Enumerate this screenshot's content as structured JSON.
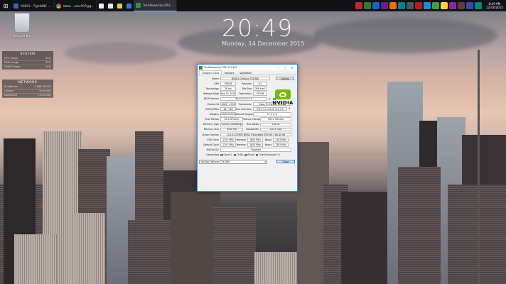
{
  "taskbar": {
    "windows": [
      {
        "label": "A0001 - TightVNC ...",
        "color": "#2a6ebd"
      },
      {
        "label": "Inbox - udu.007@g...",
        "color": "#d44235"
      },
      {
        "label": "TechPowerUp GPU-...",
        "color": "#3a8d3a"
      }
    ],
    "pinned_colors": [
      "#f2f2f2",
      "#e8e8e8",
      "#f0c040",
      "#2b7bd6"
    ],
    "tray_colors": [
      "#c62828",
      "#2e7d32",
      "#1565c0",
      "#6a1b9a",
      "#ef6c00",
      "#00838f",
      "#455a64",
      "#b71c1c",
      "#1e88e5",
      "#43a047",
      "#fdd835",
      "#8e24aa",
      "#5d4037",
      "#3949ab",
      "#00897b"
    ],
    "time": "8:49 PM",
    "date": "12/14/2015"
  },
  "lockscreen": {
    "time": "20:49",
    "date": "Monday, 14 December 2015"
  },
  "desktop": {
    "recycle_bin_label": "Recycle Bin"
  },
  "system_widget": {
    "title": "SYSTEM",
    "rows": [
      {
        "label": "CPU Usage",
        "value": "13%"
      },
      {
        "label": "RAM Usage",
        "value": "42%"
      },
      {
        "label": "SWAP Usage",
        "value": "24%"
      }
    ]
  },
  "network_widget": {
    "title": "NETWORK",
    "rows": [
      {
        "label": "IP Address",
        "value": "1.186.98.125"
      },
      {
        "label": "Upload",
        "value": "54.0 kB/s"
      },
      {
        "label": "Download",
        "value": "113.4 kB/s"
      }
    ]
  },
  "gpuz": {
    "title": "TechPowerUp GPU-Z 0.8.6",
    "tabs": [
      "Graphics Card",
      "Sensors",
      "Validation"
    ],
    "name_label": "Name",
    "name": "NVIDIA GeForce GTX 980",
    "lookup": "Lookup",
    "gpu_label": "GPU",
    "gpu": "GM204",
    "revision_label": "Revision",
    "revision": "A1",
    "tech_label": "Technology",
    "tech": "28 nm",
    "die_label": "Die Size",
    "die": "398 mm²",
    "release_label": "Release Date",
    "release": "Sep 19, 2014",
    "transistors_label": "Transistors",
    "transistors": "5200M",
    "bios_label": "BIOS Version",
    "bios": "84.04.1F.00.C8",
    "uefi": "UEFI",
    "device_label": "Device ID",
    "device": "10DE - 13C0",
    "subvendor_label": "Subvendor",
    "subvendor": "Zotac PC Partner (19DA)",
    "rops_label": "ROPs/TMUs",
    "rops": "64 / 128",
    "bus_label": "Bus Interface",
    "bus": "PCI-E 3.0 x16 @ x16 3.0",
    "shaders_label": "Shaders",
    "shaders": "2048 Unified",
    "dx_label": "DirectX Support",
    "dx": "12 (12_1)",
    "pixel_label": "Pixel Fillrate",
    "pixel": "82.6 GPixel/s",
    "texture_label": "Texture Fillrate",
    "texture": "165.2 GTexel/s",
    "memtype_label": "Memory Type",
    "memtype": "GDDR5 (Samsung)",
    "buswidth_label": "Bus Width",
    "buswidth": "256 Bit",
    "memsize_label": "Memory Size",
    "memsize": "4096 MB",
    "bandwidth_label": "Bandwidth",
    "bandwidth": "230.4 GB/s",
    "driver_label": "Driver Version",
    "driver": "10.18.13.5906 WHQL (ForceWare 359.06) / Win10 64",
    "gpuclock_label": "GPU Clock",
    "gpuclock": "1291 MHz",
    "mem1_label": "Memory",
    "mem1": "1800 MHz",
    "boost1_label": "Boost",
    "boost1": "1393 MHz",
    "defclock_label": "Default Clock",
    "defclock": "1291 MHz",
    "mem2_label": "Memory",
    "mem2": "1800 MHz",
    "boost2_label": "Boost",
    "boost2": "1393 MHz",
    "sli_label": "NVIDIA SLI",
    "sli": "Disabled",
    "computing_label": "Computing",
    "computing": [
      "OpenCL",
      "CUDA",
      "PhysX",
      "DirectCompute 5.0"
    ],
    "selected_gpu": "NVIDIA GeForce GTX 980",
    "close": "Close"
  }
}
